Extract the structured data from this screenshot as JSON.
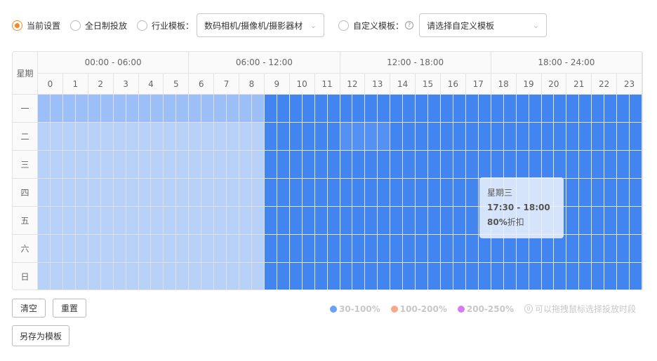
{
  "options": {
    "current": "当前设置",
    "allday": "全日制投放",
    "industry": "行业模板：",
    "industry_value": "数码相机/摄像机/摄影器材",
    "custom": "自定义模板：",
    "custom_placeholder": "请选择自定义模板",
    "help": "?"
  },
  "grid": {
    "week_label": "星期",
    "segments": [
      "00:00 - 06:00",
      "06:00 - 12:00",
      "12:00 - 18:00",
      "18:00 - 24:00"
    ],
    "hours": [
      "0",
      "1",
      "2",
      "3",
      "4",
      "5",
      "6",
      "7",
      "8",
      "9",
      "10",
      "11",
      "12",
      "13",
      "14",
      "15",
      "16",
      "17",
      "18",
      "19",
      "20",
      "21",
      "22",
      "23"
    ],
    "days": [
      "一",
      "二",
      "三",
      "四",
      "五",
      "六",
      "日"
    ],
    "colors": {
      "a": "#9dbff7",
      "b": "#b7d1f9",
      "c": "#4285f0",
      "d": "#5591f2"
    },
    "rows": [
      "aaaaaaaaaaaaaaaaaacccccccccccccccccccccccccccccc",
      "bbbbbbbbbbbbbbbbbbccccccddddcccccccccccccccccccc",
      "bbbbbbbbbbbbbbbbbbcccccccccccccccccccccccccccccc",
      "bbbbbbbbbbbbbbbbbbcccccccccccccccccccccccccccccc",
      "bbbbbbbbbbbbbbbbbbcccccccccccccccccccccccccccccc",
      "bbbbbbbbbbbbbbbbbbcccccccccccccccccccccccccccccc",
      "bbbbbbbbbbbbbbbbbbcccccccccccccccccccccccccccccc"
    ]
  },
  "tooltip": {
    "day": "星期三",
    "time": "17:30 - 18:00",
    "pct": "80%",
    "suffix": "折扣"
  },
  "buttons": {
    "clear": "清空",
    "reset": "重置",
    "save": "另存为模板"
  },
  "legend": [
    {
      "label": "30-100%",
      "color": "#6aa1f5"
    },
    {
      "label": "100-200%",
      "color": "#f9a98a"
    },
    {
      "label": "200-250%",
      "color": "#d57cf5"
    }
  ],
  "hint": "可以拖拽鼠标选择投放时段"
}
